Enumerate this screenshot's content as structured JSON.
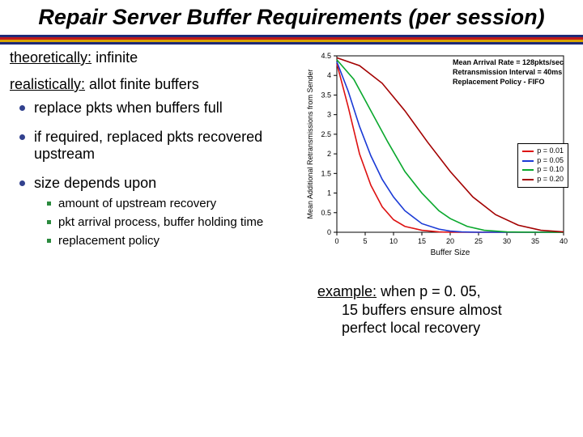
{
  "title": "Repair Server Buffer Requirements (per session)",
  "rules": [
    "#1e2a78",
    "#c01b1b",
    "#d9a400",
    "#1e2a78"
  ],
  "left": {
    "theo_label": "theoretically:",
    "theo_value": "infinite",
    "real_label": "realistically:",
    "real_value": "allot finite buffers",
    "bullets": [
      "replace pkts when buffers full",
      "if required, replaced pkts recovered upstream",
      "size depends upon"
    ],
    "sub_bullets": [
      "amount of upstream recovery",
      "pkt arrival process, buffer holding time",
      "replacement policy"
    ]
  },
  "chart_data": {
    "type": "line",
    "xlabel": "Buffer Size",
    "ylabel": "Mean Additional Retransmissions from Sender",
    "xlim": [
      0,
      40
    ],
    "ylim": [
      0,
      4.5
    ],
    "xticks": [
      0,
      5,
      10,
      15,
      20,
      25,
      30,
      35,
      40
    ],
    "yticks": [
      0,
      0.5,
      1.0,
      1.5,
      2.0,
      2.5,
      3.0,
      3.5,
      4.0,
      4.5
    ],
    "info": [
      "Mean Arrival Rate = 128pkts/sec",
      "Retransmission Interval = 40ms",
      "Replacement Policy - FIFO"
    ],
    "series": [
      {
        "name": "p = 0.01",
        "color": "#d11",
        "x": [
          0,
          2,
          4,
          6,
          8,
          10,
          12,
          15,
          18,
          20,
          25,
          30,
          35,
          40
        ],
        "y": [
          4.3,
          3.2,
          2.0,
          1.2,
          0.65,
          0.32,
          0.15,
          0.05,
          0.01,
          0.0,
          0.0,
          0.0,
          0.0,
          0.0
        ]
      },
      {
        "name": "p = 0.05",
        "color": "#1a3ad6",
        "x": [
          0,
          2,
          4,
          6,
          8,
          10,
          12,
          15,
          18,
          20,
          22,
          25,
          30,
          35,
          40
        ],
        "y": [
          4.35,
          3.6,
          2.7,
          1.95,
          1.35,
          0.9,
          0.55,
          0.22,
          0.08,
          0.03,
          0.01,
          0.0,
          0.0,
          0.0,
          0.0
        ]
      },
      {
        "name": "p = 0.10",
        "color": "#0aa82d",
        "x": [
          0,
          3,
          6,
          9,
          12,
          15,
          18,
          20,
          23,
          26,
          30,
          35,
          40
        ],
        "y": [
          4.4,
          3.9,
          3.1,
          2.3,
          1.55,
          1.0,
          0.55,
          0.35,
          0.15,
          0.05,
          0.01,
          0.0,
          0.0
        ]
      },
      {
        "name": "p = 0.20",
        "color": "#a30000",
        "x": [
          0,
          4,
          8,
          12,
          16,
          20,
          24,
          28,
          32,
          36,
          40
        ],
        "y": [
          4.45,
          4.25,
          3.8,
          3.1,
          2.3,
          1.55,
          0.9,
          0.45,
          0.18,
          0.05,
          0.01
        ]
      }
    ]
  },
  "example": {
    "label": "example:",
    "text1": "when p = 0. 05,",
    "text2": "15 buffers ensure almost",
    "text3": "perfect local recovery"
  }
}
